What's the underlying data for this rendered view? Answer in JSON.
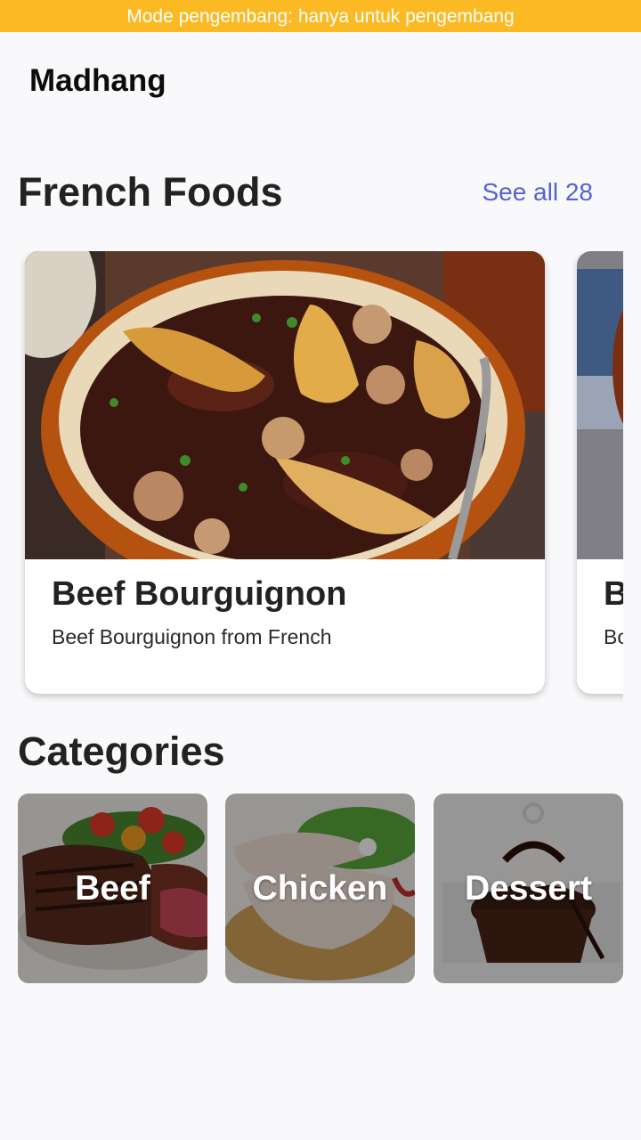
{
  "banner": {
    "text": "Mode pengembang: hanya untuk pengembang",
    "color": "#fbb924"
  },
  "app": {
    "title": "Madhang"
  },
  "french_section": {
    "title": "French Foods",
    "see_all": "See all 28",
    "accent": "#5561d8",
    "cards": [
      {
        "title": "Beef Bourguignon",
        "subtitle": "Beef Bourguignon from French",
        "image": "beef-bourguignon-photo"
      },
      {
        "title": "B",
        "subtitle": "Bo",
        "image": "dish-photo"
      }
    ]
  },
  "categories_section": {
    "title": "Categories",
    "items": [
      {
        "label": "Beef",
        "image": "beef-photo"
      },
      {
        "label": "Chicken",
        "image": "chicken-photo"
      },
      {
        "label": "Dessert",
        "image": "dessert-photo"
      }
    ]
  }
}
